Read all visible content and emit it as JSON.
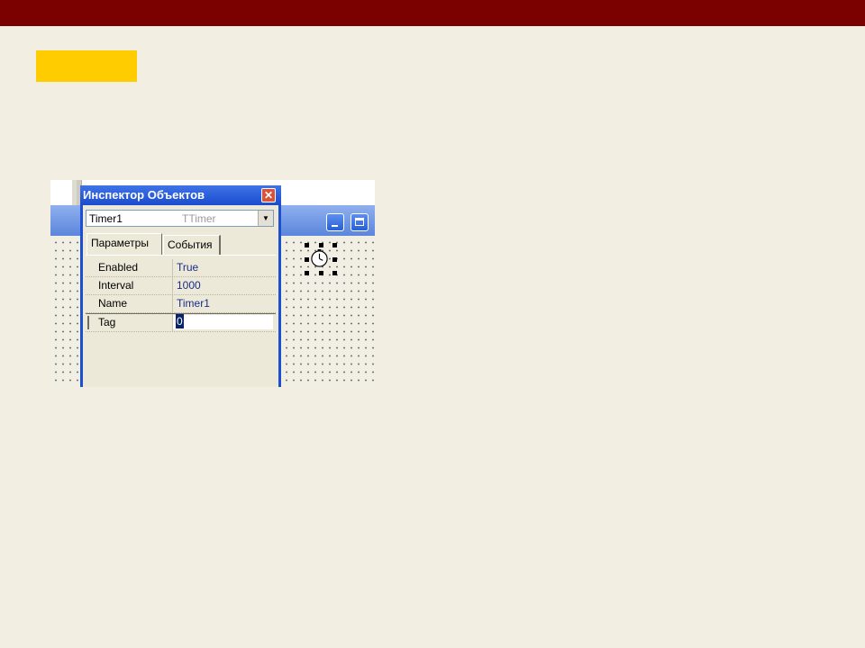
{
  "colors": {
    "top_bar": "#7b0000",
    "highlight_box": "#ffcc00",
    "slide_background": "#f2efe2",
    "inspector_frame": "#1d4fd3"
  },
  "inspector": {
    "title": "Инспектор Объектов",
    "close_icon": "close-icon",
    "combo": {
      "object_name": "Timer1",
      "object_type": "TTimer",
      "arrow_icon": "chevron-down-icon"
    },
    "tabs": [
      {
        "label": "Параметры",
        "active": true
      },
      {
        "label": "События",
        "active": false
      }
    ],
    "properties": [
      {
        "name": "Enabled",
        "value": "True"
      },
      {
        "name": "Interval",
        "value": "1000"
      },
      {
        "name": "Name",
        "value": "Timer1"
      },
      {
        "name": "Tag",
        "value": "0",
        "selected": true
      }
    ]
  },
  "form_window": {
    "minimize_icon": "minimize-icon",
    "maximize_icon": "maximize-icon",
    "component_icon": "clock-icon"
  }
}
